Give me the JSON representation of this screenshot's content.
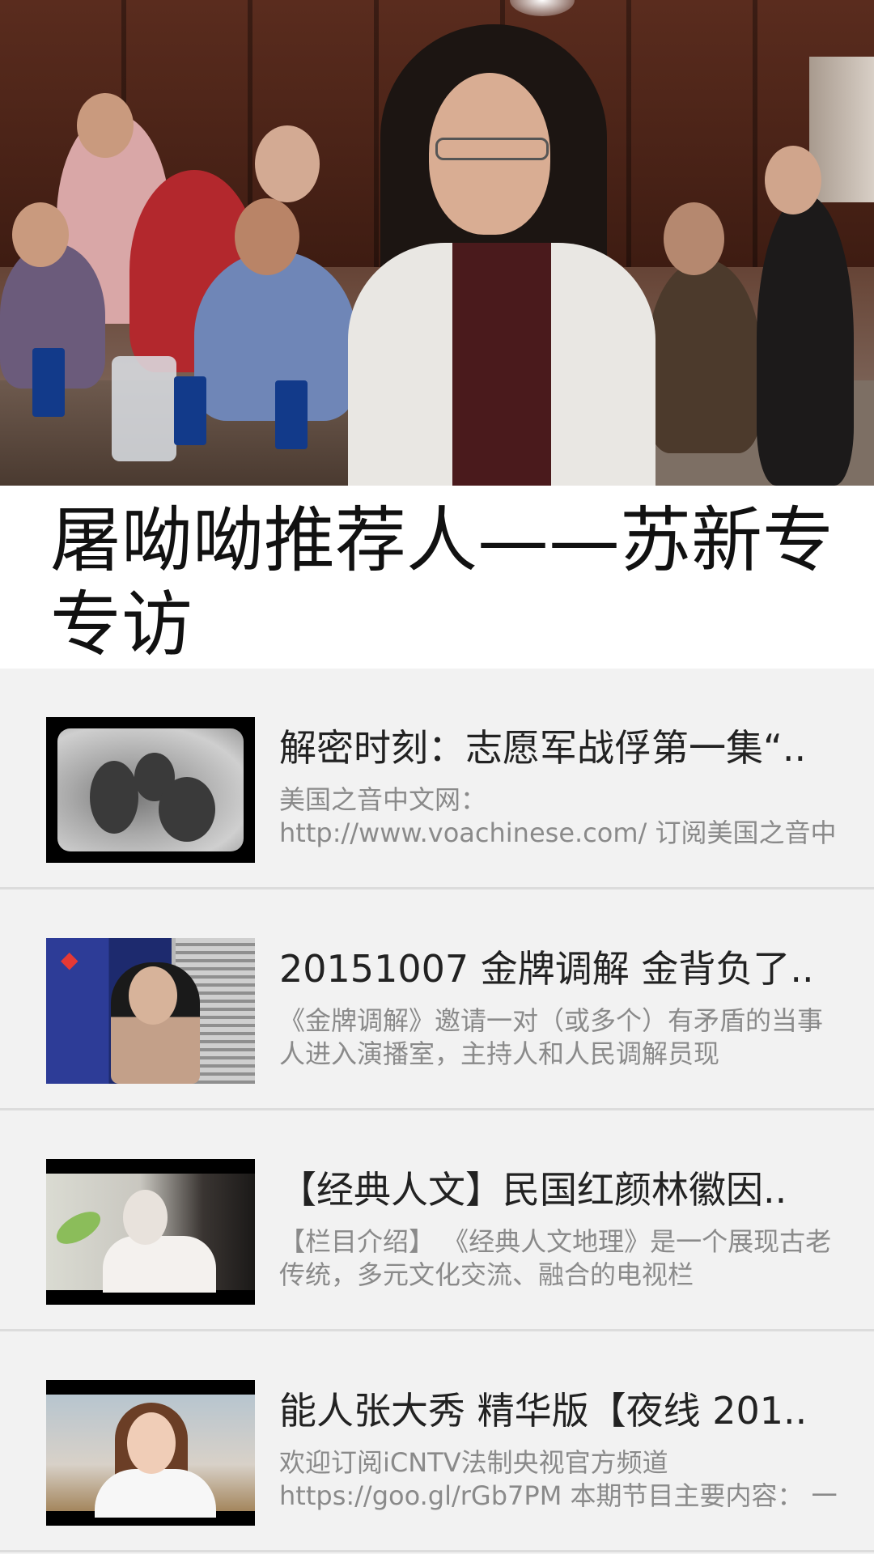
{
  "video": {
    "title": "屠呦呦推荐人——苏新专专访"
  },
  "related": [
    {
      "title": "解密时刻：志愿军战俘第一集“..",
      "description": "美国之音中文网： http://www.voachinese.com/ 订阅美国之音中文YouTube频道："
    },
    {
      "title": "20151007 金牌调解 金背负了..",
      "description": "《金牌调解》邀请一对（或多个）有矛盾的当事人进入演播室，主持人和人民调解员现"
    },
    {
      "title": "【经典人文】民国红颜林徽因..",
      "description": "【栏目介绍】 《经典人文地理》是一个展现古老传统，多元文化交流、融合的电视栏"
    },
    {
      "title": "能人张大秀 精华版【夜线 201..",
      "description": "欢迎订阅iCNTV法制央视官方频道https://goo.gl/rGb7PM 本期节目主要内容： 一个"
    }
  ]
}
